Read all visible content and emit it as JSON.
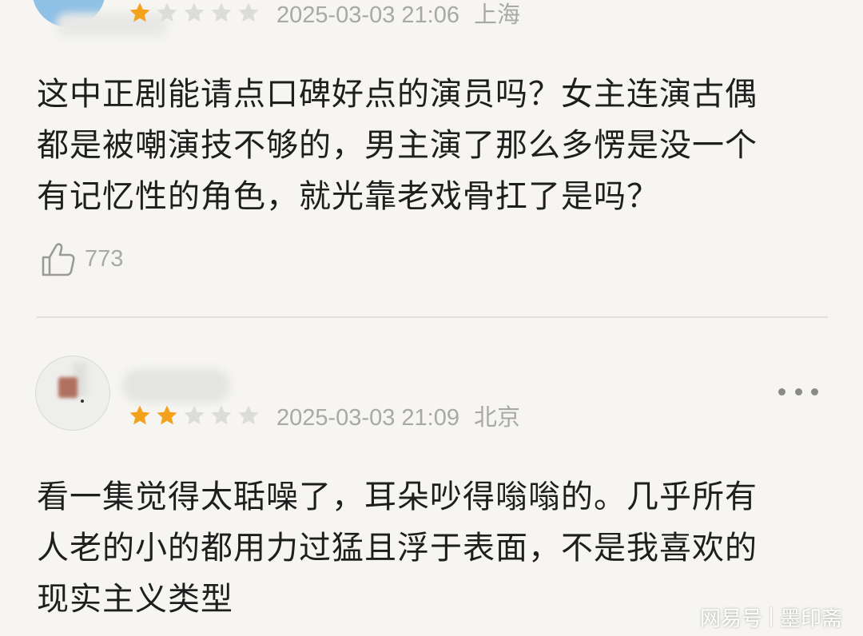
{
  "reviews": [
    {
      "rating": 1,
      "max_rating": 5,
      "date": "2025-03-03 21:06",
      "location": "上海",
      "lines": [
        "这中正剧能请点口碑好点的演员吗？女主连演古偶",
        "都是被嘲演技不够的，男主演了那么多愣是没一个",
        "有记忆性的角色，就光靠老戏骨扛了是吗？"
      ],
      "likes": "773"
    },
    {
      "rating": 2,
      "max_rating": 5,
      "date": "2025-03-03 21:09",
      "location": "北京",
      "lines": [
        "看一集觉得太聒噪了，耳朵吵得嗡嗡的。几乎所有",
        "人老的小的都用力过猛且浮于表面，不是我喜欢的",
        "现实主义类型"
      ]
    }
  ],
  "watermark": {
    "platform": "网易号",
    "author": "墨印斋"
  },
  "colors": {
    "star_filled": "#f4a11d",
    "star_empty": "#dcdcda",
    "meta_text": "#a8a8a6",
    "background": "#f6f5f1"
  },
  "icons": [
    "star-icon",
    "thumbs-up-icon",
    "more-icon"
  ]
}
